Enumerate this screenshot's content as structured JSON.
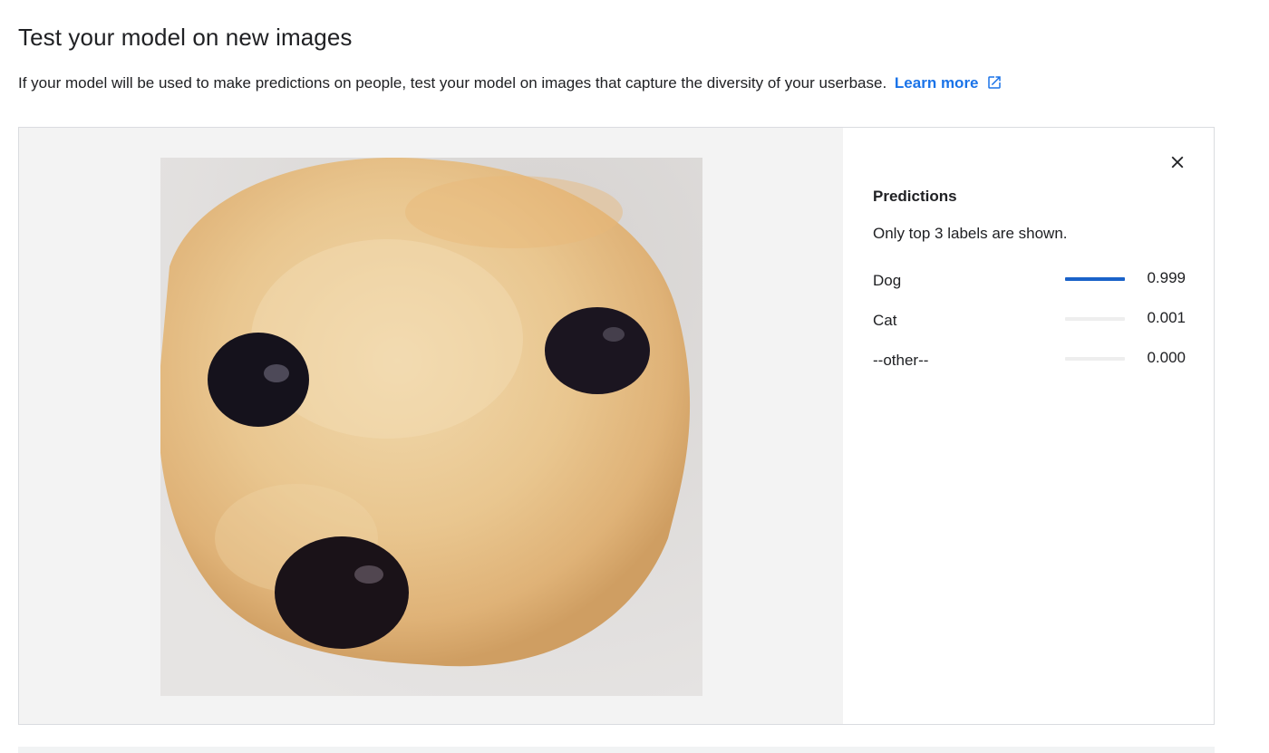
{
  "header": {
    "title": "Test your model on new images",
    "description": "If your model will be used to make predictions on people, test your model on images that capture the diversity of your userbase.",
    "learn_more_label": "Learn more",
    "learn_more_icon": "open-in-new-icon"
  },
  "preview": {
    "image_subject": "muffin resembling a dog face"
  },
  "predictions": {
    "heading": "Predictions",
    "note": "Only top 3 labels are shown.",
    "close_icon": "close-icon",
    "accent_color": "#1a62c9",
    "items": [
      {
        "label": "Dog",
        "value": "0.999",
        "score": 0.999
      },
      {
        "label": "Cat",
        "value": "0.001",
        "score": 0.001
      },
      {
        "label": "--other--",
        "value": "0.000",
        "score": 0.0
      }
    ]
  }
}
